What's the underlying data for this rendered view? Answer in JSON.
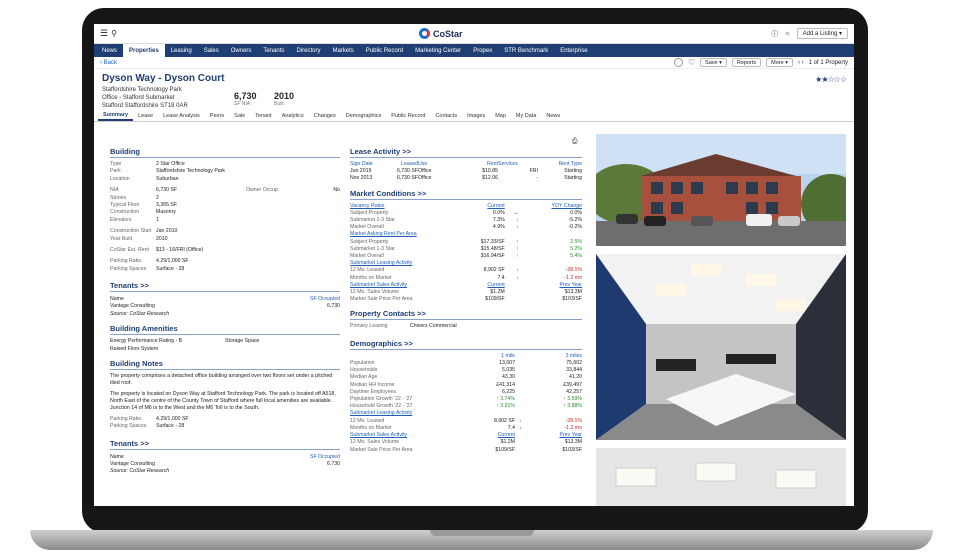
{
  "nav": [
    "News",
    "Properties",
    "Leasing",
    "Sales",
    "Owners",
    "Tenants",
    "Directory",
    "Markets",
    "Public Record",
    "Marketing Center",
    "Propex",
    "STR Benchmark",
    "Enterprise"
  ],
  "topbar": {
    "logo": "CoStar",
    "add_listing": "Add a Listing"
  },
  "subbar": {
    "back": "Back",
    "save": "Save",
    "reports": "Reports",
    "more": "More",
    "pager": "1 of 1 Property"
  },
  "property": {
    "title": "Dyson Way - Dyson Court",
    "addr1": "Staffordshire Technology Park",
    "addr2": "Office - Stafford Submarket",
    "addr3": "Stafford Staffordshire ST18 0AR",
    "sf": "6,730",
    "sf_label": "SF NIA",
    "built": "2010",
    "built_label": "Built",
    "stars": "★★☆☆☆"
  },
  "tabs": [
    "Summary",
    "Lease",
    "Lease Analysis",
    "Peers",
    "Sale",
    "Tenant",
    "Analytics",
    "Changes",
    "Demographics",
    "Public Record",
    "Contacts",
    "Images",
    "Map",
    "My Data",
    "News"
  ],
  "building": {
    "title": "Building",
    "rows": [
      [
        "Type",
        "2 Star Office"
      ],
      [
        "Park",
        "Staffordshire Technology Park"
      ],
      [
        "Location",
        "Suburban"
      ]
    ],
    "nia_k": "NIA",
    "nia_v": "6,730 SF",
    "owner_k": "Owner Occup",
    "owner_v": "No",
    "rows2": [
      [
        "Stories",
        "2"
      ],
      [
        "Typical Floor",
        "3,365 SF"
      ],
      [
        "Construction",
        "Masonry"
      ],
      [
        "Elevators",
        "1"
      ]
    ],
    "rows3": [
      [
        "Construction Start",
        "Jan 2010"
      ],
      [
        "Year Built",
        "2010"
      ]
    ],
    "rows4": [
      [
        "CoStar Est. Rent",
        "$13 - 16/FRI (Office)"
      ]
    ],
    "rows5": [
      [
        "Parking Ratio",
        "4.29/1,000 SF"
      ],
      [
        "Parking Spaces",
        "Surface - 28"
      ]
    ]
  },
  "tenants": {
    "title": "Tenants >>",
    "h_name": "Name",
    "h_sf": "SF Occupied",
    "name": "Vantage Consulting",
    "sf": "6,730",
    "source": "Source: CoStar Research"
  },
  "amenities": {
    "title": "Building Amenities",
    "a1": "Energy Performance Rating - B",
    "a2": "Storage Space",
    "a3": "Raised Floor System"
  },
  "notes": {
    "title": "Building Notes",
    "p1": "The property comprises a detached office building arranged over two floors set under a pitched tiled roof.",
    "p2": "The property is located on Dyson Way at Stafford Technology Park. The park is located off A518, North East of the centre of the County Town of Stafford where full local amenities are available. Junction 14 of M6 is to the West and the M6 Toll is to the South.",
    "pr_k": "Parking Ratio",
    "pr_v": "4.29/1,000 SF",
    "ps_k": "Parking Spaces",
    "ps_v": "Surface - 28"
  },
  "lease": {
    "title": "Lease Activity >>",
    "h": [
      "Sign Date",
      "Leased",
      "Use",
      "Rent",
      "Services",
      "Rent Type"
    ],
    "rows": [
      [
        "Jun 2019",
        "6,730 SF",
        "Office",
        "$10.85",
        "FRI",
        "Starting"
      ],
      [
        "Nov 2013",
        "6,730 SF",
        "Office",
        "$12.06",
        "-",
        "Starting"
      ]
    ]
  },
  "market": {
    "title": "Market Conditions >>",
    "vac": "Vacancy Rates",
    "h_cur": "Current",
    "h_yoy": "YOY Change",
    "vrows": [
      [
        "Subject Property",
        "0.0%",
        "↔",
        "0.0%",
        "n"
      ],
      [
        "Submarket 1-3 Star",
        "7.3%",
        "↓",
        "-5.2%",
        "up"
      ],
      [
        "Market Overall",
        "4.9%",
        "↓",
        "-0.2%",
        "up"
      ]
    ],
    "ask": "Market Asking Rent Per Area",
    "arows": [
      [
        "Subject Property",
        "$17.33/SF",
        "↑",
        "2.5%",
        "up"
      ],
      [
        "Submarket 1-3 Star",
        "$15.48/SF",
        "↑",
        "5.2%",
        "up"
      ],
      [
        "Market Overall",
        "$16.94/SF",
        "↑",
        "5.4%",
        "up"
      ]
    ],
    "sla": "Submarket Leasing Activity",
    "lrows": [
      [
        "12 Mo. Leased",
        "8,902 SF",
        "↓",
        "-28.1%",
        "dn"
      ],
      [
        "Months on Market",
        "7.4",
        "↓",
        "-1.2 mo",
        "dn"
      ]
    ],
    "ssa": "Submarket Sales Activity",
    "h_prev": "Prev Year",
    "srows": [
      [
        "12 Mo. Sales Volume",
        "$1.2M",
        "$13.3M"
      ],
      [
        "Market Sale Price Per Area",
        "$109/SF",
        "$103/SF"
      ]
    ]
  },
  "contacts": {
    "title": "Property Contacts >>",
    "k": "Primary Leasing",
    "v": "Chivers Commercial"
  },
  "demo": {
    "title": "Demographics >>",
    "h1": "1 mile",
    "h3": "3 miles",
    "rows": [
      [
        "Population",
        "13,007",
        "75,602"
      ],
      [
        "Households",
        "5,035",
        "33,844"
      ],
      [
        "Median Age",
        "43.30",
        "41.20"
      ],
      [
        "Median HH Income",
        "£41,314",
        "£39,497"
      ],
      [
        "Daytime Employees",
        "6,225",
        "42,257"
      ]
    ],
    "growth_k": "Population Growth '22 - '27",
    "growth1": "↑ 3.74%",
    "growth3": "↑ 3.59%",
    "hh_k": "Household Growth '22 - '27",
    "hh1": "↑ 3.91%",
    "hh3": "↑ 3.88%",
    "sla": "Submarket Leasing Activity",
    "lrows": [
      [
        "12 Mo. Leased",
        "8,902 SF",
        "↓",
        "-28.1%"
      ],
      [
        "Months on Market",
        "7.4",
        "↓",
        "-1.2 mo"
      ]
    ],
    "ssa": "Submarket Sales Activity",
    "h_cur": "Current",
    "h_prev": "Prev Year",
    "srows": [
      [
        "12 Mo. Sales Volume",
        "$1.2M",
        "$13.3M"
      ],
      [
        "Market Sale Price Per Area",
        "$109/SF",
        "$103/SF"
      ]
    ]
  }
}
